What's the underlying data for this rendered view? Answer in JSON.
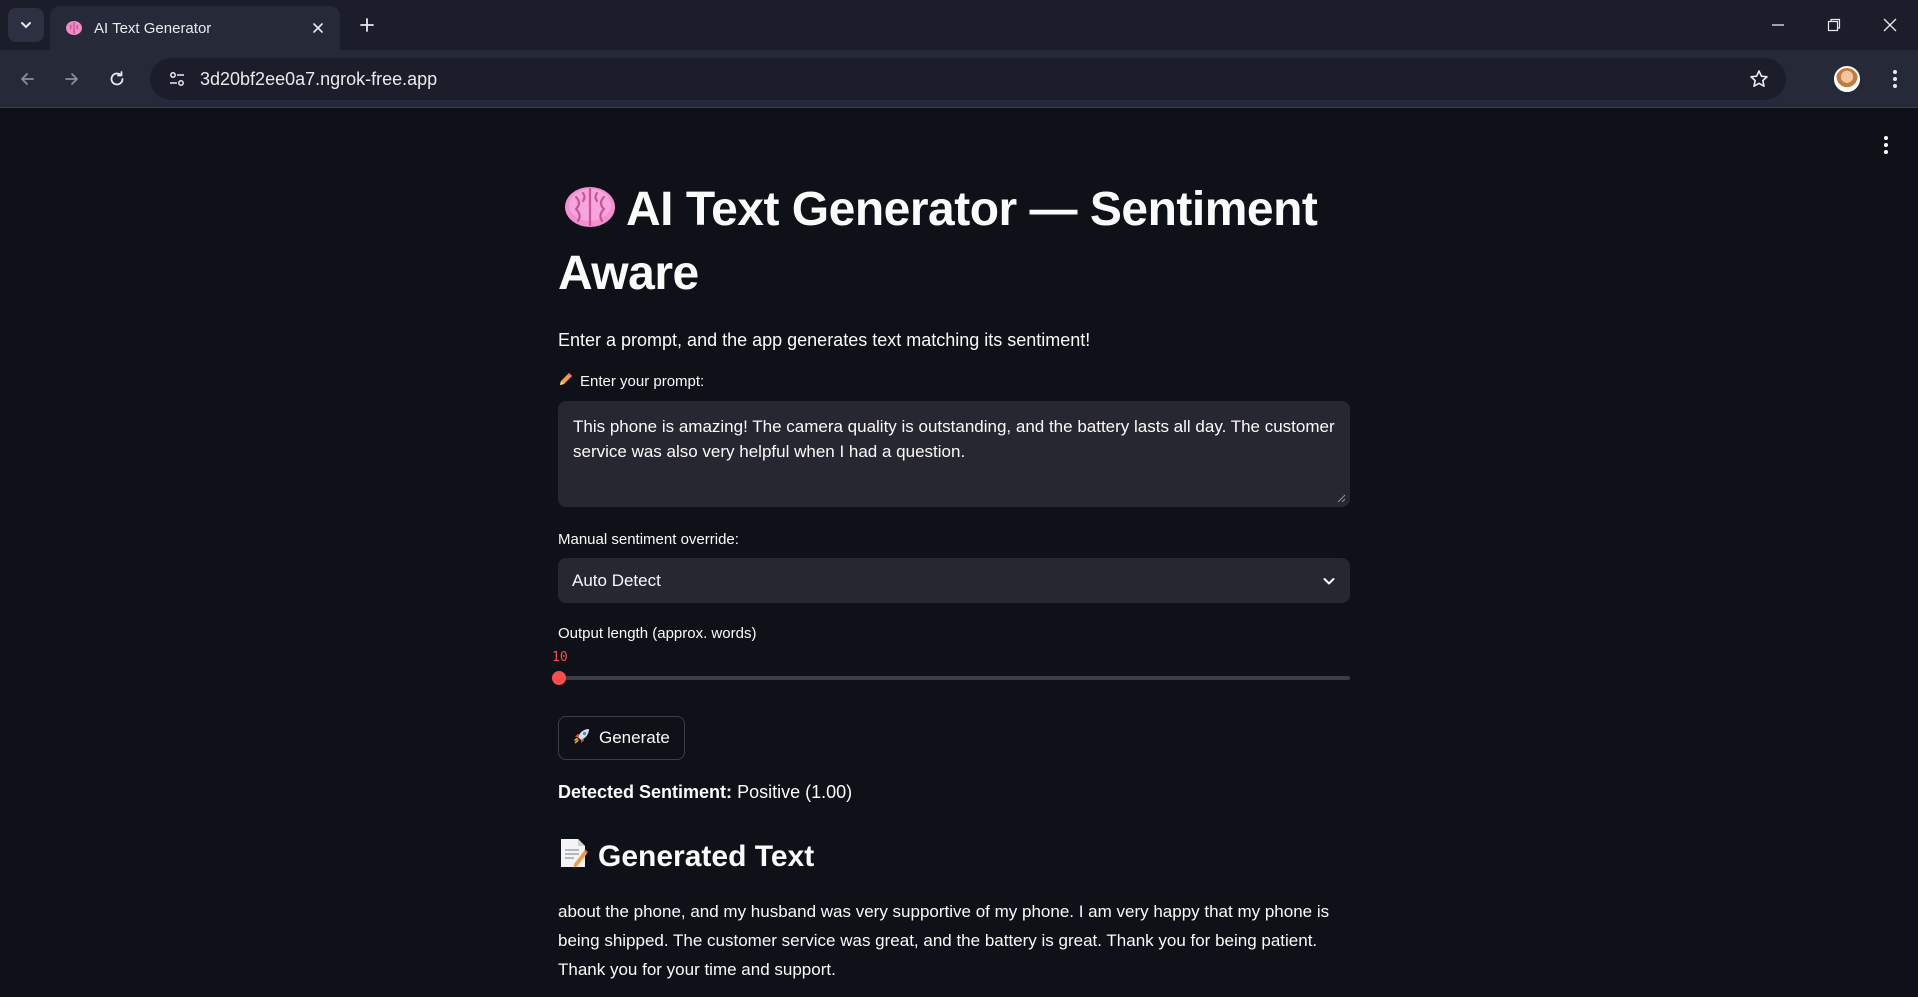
{
  "browser": {
    "tab_title": "AI Text Generator",
    "url": "3d20bf2ee0a7.ngrok-free.app"
  },
  "app": {
    "title_emoji": "🧠",
    "title": "AI Text Generator — Sentiment Aware",
    "description": "Enter a prompt, and the app generates text matching its sentiment!",
    "prompt": {
      "label_emoji": "✏️",
      "label": "Enter your prompt:",
      "value": "This phone is amazing! The camera quality is outstanding, and the battery lasts all day. The customer service was also very helpful when I had a question."
    },
    "sentiment_override": {
      "label": "Manual sentiment override:",
      "selected": "Auto Detect"
    },
    "output_length": {
      "label": "Output length (approx. words)",
      "value": "10",
      "fraction": 0
    },
    "generate_button": {
      "emoji": "🚀",
      "label": "Generate"
    },
    "detected": {
      "label": "Detected Sentiment:",
      "value": "Positive (1.00)"
    },
    "generated": {
      "emoji": "📝",
      "heading": "Generated Text",
      "text": "about the phone, and my husband was very supportive of my phone. I am very happy that my phone is being shipped. The customer service was great, and the battery is great. Thank you for being patient. Thank you for your time and support."
    }
  },
  "colors": {
    "accent": "#ff4b4b",
    "background": "#0e1117",
    "input_bg": "#262730"
  }
}
